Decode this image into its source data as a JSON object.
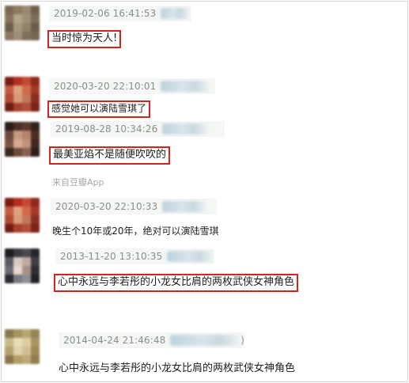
{
  "comments": [
    {
      "timestamp": "2019-02-06 16:41:53",
      "text": "当时惊为天人!",
      "highlighted": true,
      "avatar_colors": [
        "#7a6a55",
        "#8c7a62",
        "#9a8870",
        "#6f604c",
        "#857560",
        "#b3a58c",
        "#a08f78",
        "#7d6e5a",
        "#6b5e4b",
        "#a6977f",
        "#928268",
        "#6a5c48",
        "#8a7a64",
        "#9d8d75",
        "#7f705b",
        "#746651"
      ]
    },
    {
      "timestamp": "2020-03-20 22:10:01",
      "text": "感觉她可以演陆雪琪了",
      "highlighted": true,
      "avatar_colors": [
        "#7a1c14",
        "#b23020",
        "#c44a34",
        "#8e2a1e",
        "#c35a40",
        "#e0a080",
        "#d06a4a",
        "#a33a28",
        "#b04a36",
        "#d8987a",
        "#c07858",
        "#8a2e20",
        "#6e1e16",
        "#a8402c",
        "#b0503a",
        "#7c2418"
      ]
    },
    {
      "timestamp": "2019-08-28 10:34:26",
      "text": "最美亚焰不是随便吹吹的",
      "highlighted": true,
      "source": "来自豆瓣App",
      "avatar_colors": [
        "#2a1d18",
        "#4a3028",
        "#5a3a30",
        "#33221c",
        "#6a4a3c",
        "#c8987e",
        "#b6846a",
        "#4a2e24",
        "#7a5444",
        "#d4aa90",
        "#c09276",
        "#3e281f",
        "#3a261e",
        "#6e4a3a",
        "#8a6250",
        "#2e1f19"
      ]
    },
    {
      "timestamp": "2020-03-20 22:10:33",
      "text": "晚生个10年或20年，绝对可以演陆雪琪",
      "highlighted": false,
      "avatar_colors": [
        "#7a1c14",
        "#b23020",
        "#c44a34",
        "#8e2a1e",
        "#c35a40",
        "#e0a080",
        "#d06a4a",
        "#a33a28",
        "#b04a36",
        "#d8987a",
        "#c07858",
        "#8a2e20",
        "#6e1e16",
        "#a8402c",
        "#b0503a",
        "#7c2418"
      ]
    },
    {
      "timestamp": "2013-11-20 13:10:35",
      "text": "心中永远与李若彤的小龙女比肩的两枚武侠女神角色",
      "highlighted": true,
      "avatar_colors": [
        "#1e1e22",
        "#3a3a40",
        "#4a4a52",
        "#26262c",
        "#5a5a62",
        "#d8c8c0",
        "#c0aaa0",
        "#3e3e46",
        "#6a6a72",
        "#e6d6ce",
        "#a89088",
        "#2e2e34",
        "#2a2a30",
        "#7a7a82",
        "#8e8e96",
        "#222226"
      ]
    },
    {
      "timestamp": "2014-04-24 21:46:48",
      "text": "心中永远与李若彤的小龙女比肩的两枚武侠女神角色",
      "highlighted": false,
      "username_suffix": ")",
      "avatar_colors": [
        "#8c7a4e",
        "#a6945e",
        "#b8a672",
        "#968454",
        "#c8b888",
        "#e8dcb8",
        "#dccca0",
        "#a89660",
        "#b4a26c",
        "#e0d2aa",
        "#d0c094",
        "#9c8a58",
        "#8a784c",
        "#b09e68",
        "#bca978",
        "#907e50"
      ]
    }
  ]
}
